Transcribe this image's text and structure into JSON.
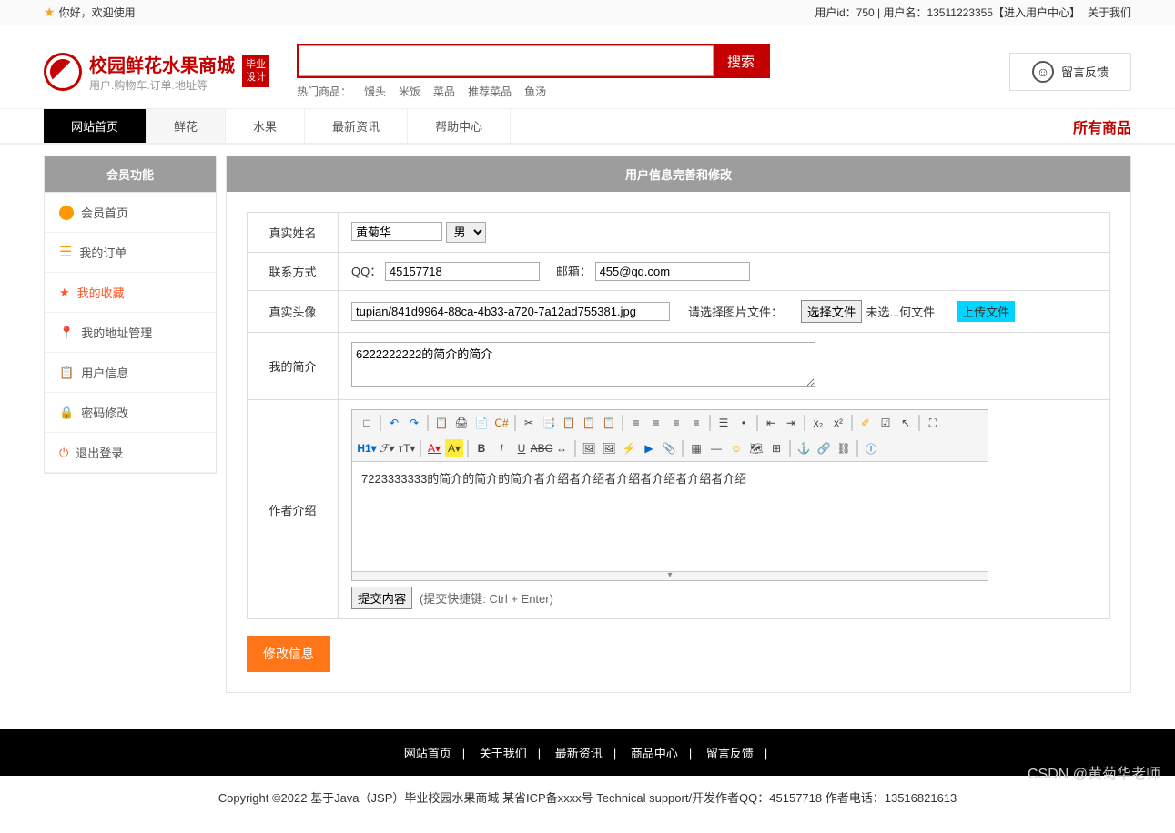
{
  "topbar": {
    "welcome_prefix": "你好，欢迎使用",
    "right_text": "用户id：750 | 用户名：13511223355【进入用户中心】",
    "about": "关于我们"
  },
  "logo": {
    "title": "校园鲜花水果商城",
    "subtitle": "用户.购物车.订单.地址等",
    "badge_line1": "毕业",
    "badge_line2": "设计"
  },
  "search": {
    "button": "搜索",
    "hot_label": "热门商品：",
    "hot_items": [
      "馒头",
      "米饭",
      "菜品",
      "推荐菜品",
      "鱼汤"
    ]
  },
  "feedback_label": "留言反馈",
  "nav": {
    "items": [
      "网站首页",
      "鲜花",
      "水果",
      "最新资讯",
      "帮助中心"
    ],
    "all_goods": "所有商品"
  },
  "sidebar": {
    "title": "会员功能",
    "items": [
      {
        "label": "会员首页"
      },
      {
        "label": "我的订单"
      },
      {
        "label": "我的收藏"
      },
      {
        "label": "我的地址管理"
      },
      {
        "label": "用户信息"
      },
      {
        "label": "密码修改"
      },
      {
        "label": "退出登录"
      }
    ]
  },
  "content": {
    "title": "用户信息完善和修改",
    "real_name_label": "真实姓名",
    "real_name_value": "黄菊华",
    "gender_value": "男",
    "contact_label": "联系方式",
    "qq_label": "QQ：",
    "qq_value": "45157718",
    "email_label": "邮箱：",
    "email_value": "455@qq.com",
    "avatar_label": "真实头像",
    "avatar_value": "tupian/841d9964-88ca-4b33-a720-7a12ad755381.jpg",
    "pick_file_label": "请选择图片文件：",
    "choose_file_btn": "选择文件",
    "no_file_text": "未选...何文件",
    "upload_btn": "上传文件",
    "intro_label": "我的简介",
    "intro_value": "6222222222的简介的简介",
    "author_label": "作者介绍",
    "author_html": "7223333333的简介的简介的简介者介绍者介绍者介绍者介绍者介绍者介绍",
    "submit_content_btn": "提交内容",
    "submit_hint": "(提交快捷键: Ctrl + Enter)",
    "modify_btn": "修改信息"
  },
  "footer": {
    "links": [
      "网站首页",
      "关于我们",
      "最新资讯",
      "商品中心",
      "留言反馈"
    ],
    "copyright": "Copyright ©2022 基于Java（JSP）毕业校园水果商城    某省ICP备xxxx号    Technical support/开发作者QQ：45157718     作者电话：13516821613"
  },
  "watermark": "CSDN @黄菊华老师"
}
